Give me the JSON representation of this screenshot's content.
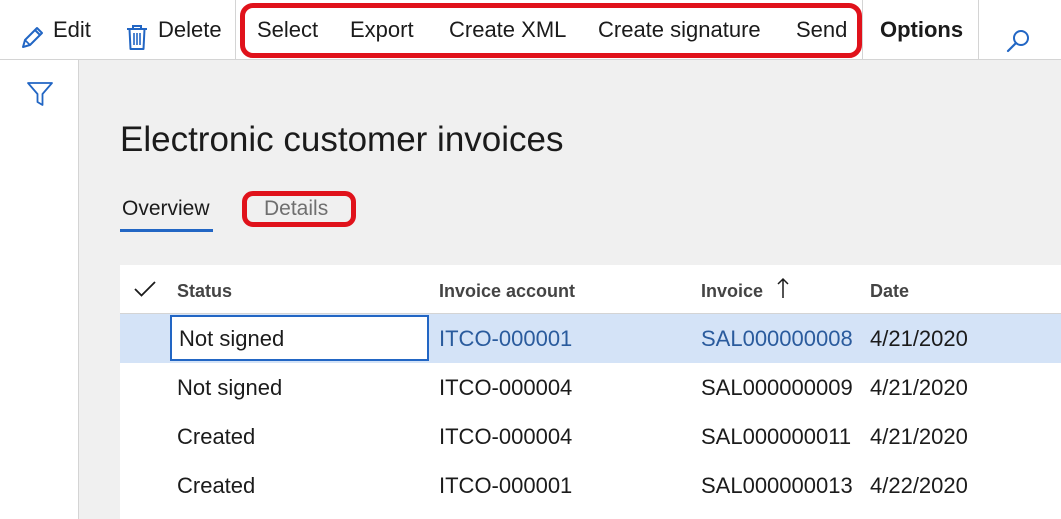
{
  "toolbar": {
    "edit_label": "Edit",
    "delete_label": "Delete",
    "select_label": "Select",
    "export_label": "Export",
    "create_xml_label": "Create XML",
    "create_signature_label": "Create signature",
    "send_label": "Send",
    "options_label": "Options"
  },
  "page": {
    "title": "Electronic customer invoices"
  },
  "tabs": [
    {
      "label": "Overview",
      "selected": true
    },
    {
      "label": "Details",
      "selected": false
    }
  ],
  "grid": {
    "columns": [
      "Status",
      "Invoice account",
      "Invoice",
      "Date"
    ],
    "sort_column": "Invoice",
    "sort_direction": "ascending",
    "rows": [
      {
        "status": "Not signed",
        "account": "ITCO-000001",
        "invoice": "SAL000000008",
        "date": "4/21/2020",
        "selected": true
      },
      {
        "status": "Not signed",
        "account": "ITCO-000004",
        "invoice": "SAL000000009",
        "date": "4/21/2020",
        "selected": false
      },
      {
        "status": "Created",
        "account": "ITCO-000004",
        "invoice": "SAL000000011",
        "date": "4/21/2020",
        "selected": false
      },
      {
        "status": "Created",
        "account": "ITCO-000001",
        "invoice": "SAL000000013",
        "date": "4/22/2020",
        "selected": false
      }
    ]
  },
  "colors": {
    "highlight_box": "#e0121b",
    "accent": "#2266c4",
    "link": "#2a5b9d",
    "selected_row": "#d4e3f7"
  },
  "icons": {
    "edit": "pencil-icon",
    "delete": "trash-icon",
    "search": "search-icon",
    "filter": "filter-icon",
    "select_all": "checkmark-icon",
    "sort": "sort-ascending-arrow-icon"
  }
}
